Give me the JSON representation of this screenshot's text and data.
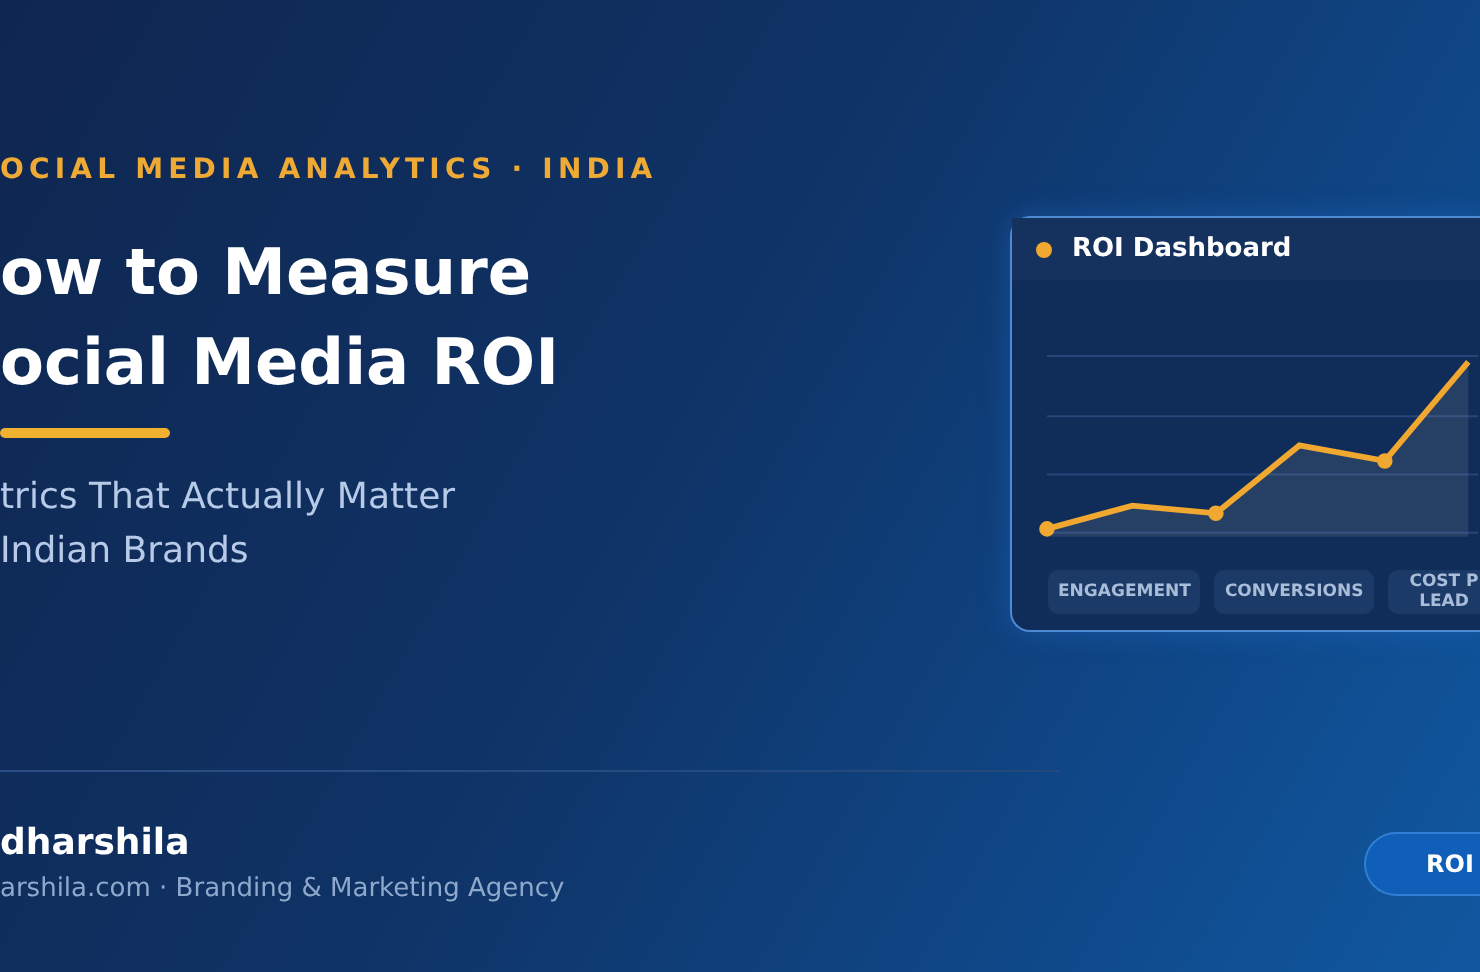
{
  "eyebrow": "OCIAL MEDIA ANALYTICS · INDIA",
  "title_lines": [
    "ow to Measure",
    "ocial Media ROI"
  ],
  "subtitle_lines": [
    "trics That Actually Matter",
    "Indian Brands"
  ],
  "dashboard": {
    "title": "ROI Dashboard",
    "chips": [
      {
        "lines": [
          "ENGAGEMENT"
        ]
      },
      {
        "lines": [
          "CONVERSIONS"
        ]
      },
      {
        "lines": [
          "COST P",
          "LEAD"
        ]
      }
    ]
  },
  "footer": {
    "brand": "dharshila",
    "tagline": "arshila.com · Branding & Marketing Agency",
    "button": "ROI"
  }
}
